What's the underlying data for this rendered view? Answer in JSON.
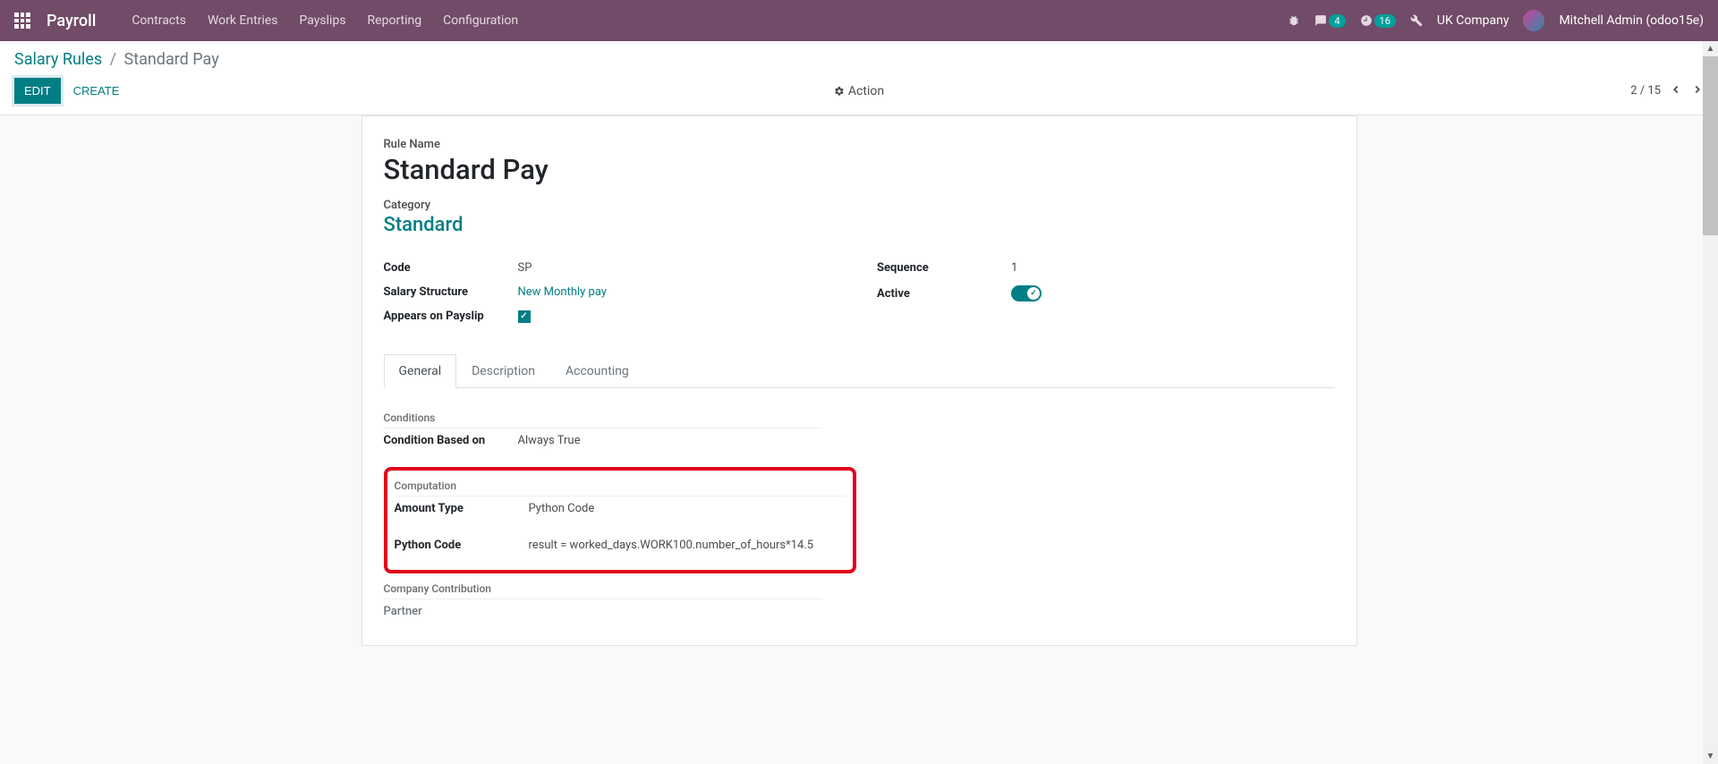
{
  "topbar": {
    "app": "Payroll",
    "menu": [
      "Contracts",
      "Work Entries",
      "Payslips",
      "Reporting",
      "Configuration"
    ],
    "msg_badge": "4",
    "clock_badge": "16",
    "company": "UK Company",
    "user": "Mitchell Admin (odoo15e)"
  },
  "breadcrumb": {
    "root": "Salary Rules",
    "current": "Standard Pay"
  },
  "buttons": {
    "edit": "EDIT",
    "create": "CREATE",
    "action": "Action"
  },
  "pager": {
    "pos": "2 / 15"
  },
  "record": {
    "rule_name_label": "Rule Name",
    "rule_name": "Standard Pay",
    "category_label": "Category",
    "category": "Standard",
    "code_label": "Code",
    "code": "SP",
    "salary_structure_label": "Salary Structure",
    "salary_structure": "New Monthly pay",
    "appears_label": "Appears on Payslip",
    "sequence_label": "Sequence",
    "sequence": "1",
    "active_label": "Active"
  },
  "tabs": [
    "General",
    "Description",
    "Accounting"
  ],
  "general": {
    "conditions_head": "Conditions",
    "condition_based_label": "Condition Based on",
    "condition_based_value": "Always True",
    "computation_head": "Computation",
    "amount_type_label": "Amount Type",
    "amount_type_value": "Python Code",
    "python_code_label": "Python Code",
    "python_code_value": "result = worked_days.WORK100.number_of_hours*14.5",
    "company_contrib_head": "Company Contribution",
    "partner_label": "Partner"
  }
}
